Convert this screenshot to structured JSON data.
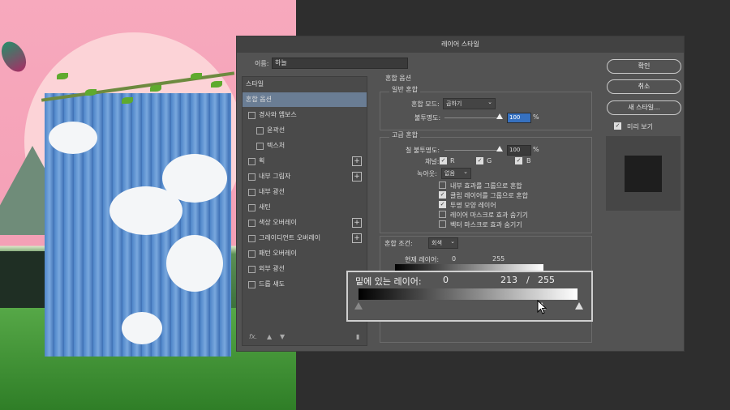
{
  "dialog": {
    "title": "레이어 스타일",
    "name_label": "이름:",
    "name_value": "하늘"
  },
  "styles": {
    "header": "스타일",
    "items": [
      {
        "label": "혼합 옵션",
        "selected": true,
        "checkbox": false,
        "plus": false
      },
      {
        "label": "경사와 엠보스",
        "checkbox": true,
        "plus": false
      },
      {
        "label": "윤곽선",
        "checkbox": true,
        "plus": false,
        "indent": true
      },
      {
        "label": "텍스처",
        "checkbox": true,
        "plus": false,
        "indent": true
      },
      {
        "label": "획",
        "checkbox": true,
        "plus": true
      },
      {
        "label": "내부 그림자",
        "checkbox": true,
        "plus": true
      },
      {
        "label": "내부 광선",
        "checkbox": true,
        "plus": false
      },
      {
        "label": "새틴",
        "checkbox": true,
        "plus": false
      },
      {
        "label": "색상 오버레이",
        "checkbox": true,
        "plus": true
      },
      {
        "label": "그레이디언트 오버레이",
        "checkbox": true,
        "plus": true
      },
      {
        "label": "패턴 오버레이",
        "checkbox": true,
        "plus": false
      },
      {
        "label": "외부 광선",
        "checkbox": true,
        "plus": false
      },
      {
        "label": "드롭 섀도",
        "checkbox": true,
        "plus": false
      }
    ],
    "footer_fx": "fx."
  },
  "blend": {
    "section": "혼합 옵션",
    "general": {
      "title": "일반 혼합",
      "mode_label": "혼합 모드:",
      "mode_value": "곱하기",
      "opacity_label": "불투명도:",
      "opacity_value": "100",
      "opacity_unit": "%"
    },
    "advanced": {
      "title": "고급 혼합",
      "fill_label": "칠 불투명도:",
      "fill_value": "100",
      "fill_unit": "%",
      "channels_label": "채널:",
      "channels": [
        "R",
        "G",
        "B"
      ],
      "knockout_label": "녹아웃:",
      "knockout_value": "없음",
      "options": [
        {
          "label": "내부 효과를 그룹으로 혼합",
          "checked": false
        },
        {
          "label": "클립 레이어를 그룹으로 혼합",
          "checked": true
        },
        {
          "label": "투명 모양 레이어",
          "checked": true
        },
        {
          "label": "레이어 마스크로 효과 숨기기",
          "checked": false
        },
        {
          "label": "벡터 마스크로 효과 숨기기",
          "checked": false
        }
      ]
    },
    "blend_if": {
      "label": "혼합 조건:",
      "value": "회색",
      "current_label": "현재 레이어:",
      "current_low": "0",
      "current_high": "255"
    }
  },
  "callout": {
    "label": "밑에 있는 레이어:",
    "low": "0",
    "mid": "213",
    "sep": "/",
    "high": "255"
  },
  "buttons": {
    "ok": "확인",
    "cancel": "취소",
    "new_style": "새 스타일...",
    "preview_label": "미리 보기"
  },
  "colors": {
    "selection": "#6a7d94",
    "accent": "#3671c0"
  }
}
